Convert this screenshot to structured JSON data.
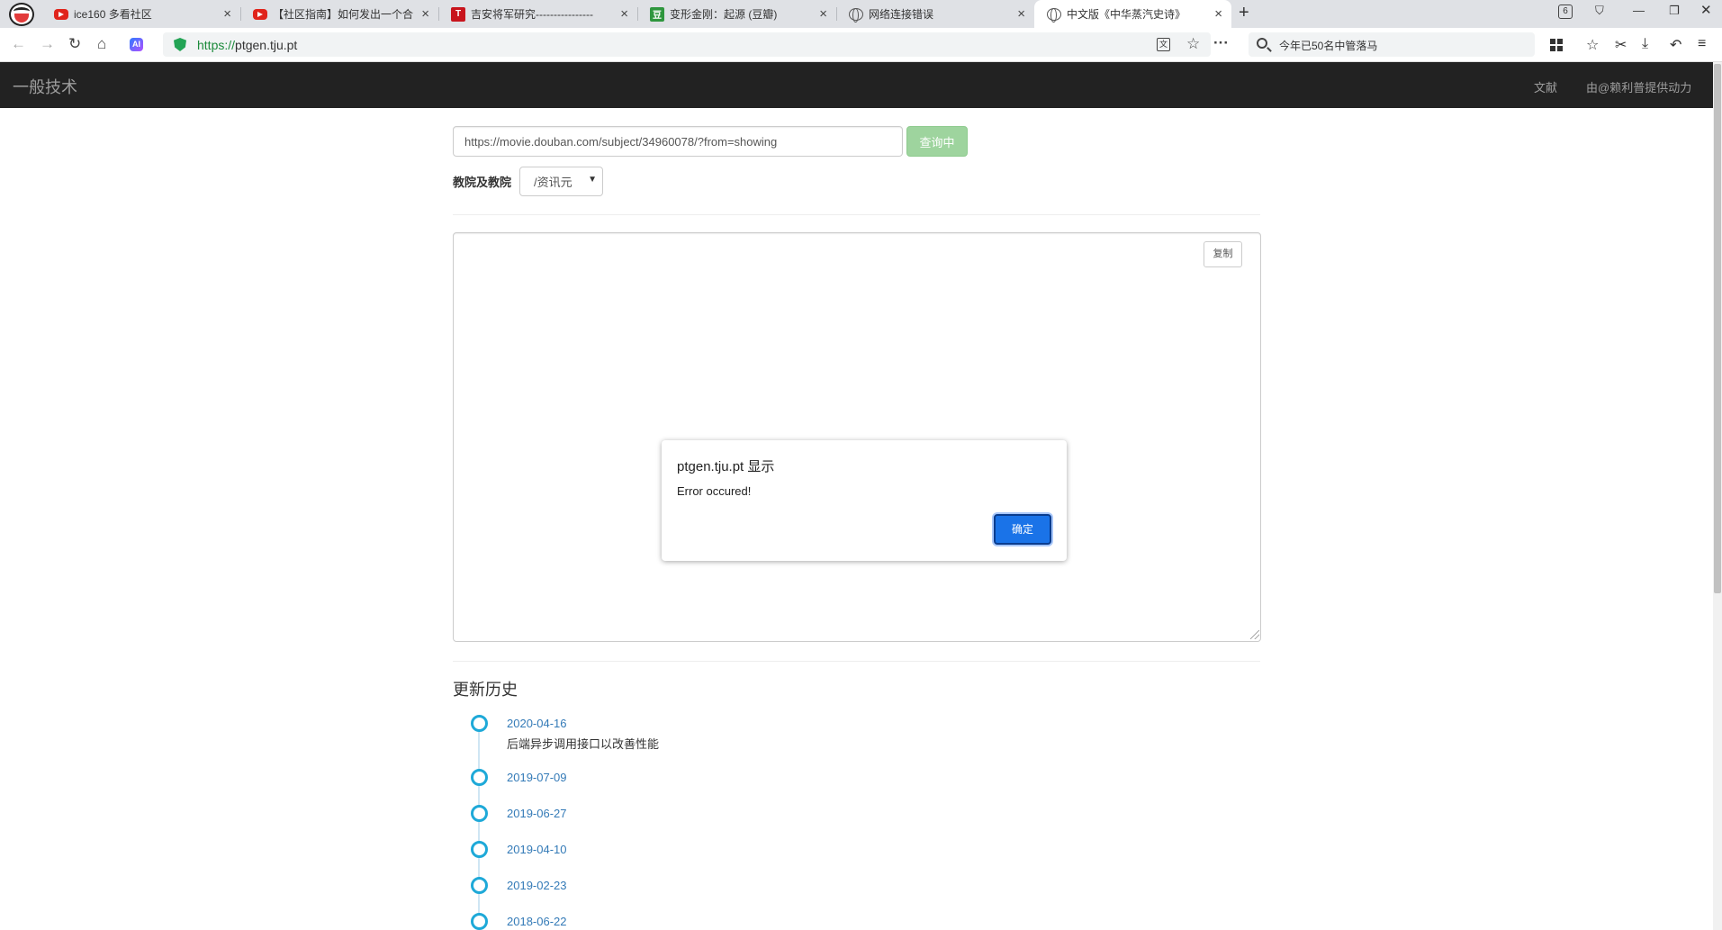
{
  "browser": {
    "tabs": [
      {
        "title": "ice160 多看社区",
        "icon": "youtube-icon"
      },
      {
        "title": "【社区指南】如何发出一个合",
        "icon": "youtube-icon"
      },
      {
        "title": "吉安将军研究----------------",
        "icon": "t-icon"
      },
      {
        "title": "变形金刚：起源 (豆瓣)",
        "icon": "douban-icon"
      },
      {
        "title": "网络连接错误",
        "icon": "globe-icon"
      },
      {
        "title": "中文版《中华蒸汽史诗》",
        "icon": "globe-icon",
        "active": true
      }
    ],
    "tab_count": "6",
    "url_scheme": "https://",
    "url_host": "ptgen.tju.pt",
    "search_text": "今年已50名中管落马",
    "ai_label": "AI"
  },
  "navbar": {
    "brand": "一般技术",
    "links": [
      "文献",
      "由@赖利普提供动力"
    ]
  },
  "form": {
    "url_value": "https://movie.douban.com/subject/34960078/?from=showing",
    "query_button": "查询中",
    "site_label": "教院及教院",
    "site_selected": "/资讯元"
  },
  "result": {
    "copy_button": "复制"
  },
  "dialog": {
    "title": "ptgen.tju.pt 显示",
    "message": "Error occured!",
    "ok_button": "确定"
  },
  "history": {
    "title": "更新历史",
    "items": [
      {
        "date": "2020-04-16",
        "desc": "后端异步调用接口以改善性能"
      },
      {
        "date": "2019-07-09",
        "desc": ""
      },
      {
        "date": "2019-06-27",
        "desc": ""
      },
      {
        "date": "2019-04-10",
        "desc": ""
      },
      {
        "date": "2019-02-23",
        "desc": ""
      },
      {
        "date": "2018-06-22",
        "desc": ""
      }
    ]
  },
  "colors": {
    "navbar_bg": "#222222",
    "query_btn": "#9ed49e",
    "timeline_dot": "#1ea9d8",
    "link": "#337ab7",
    "dialog_ok": "#1a73e8"
  }
}
